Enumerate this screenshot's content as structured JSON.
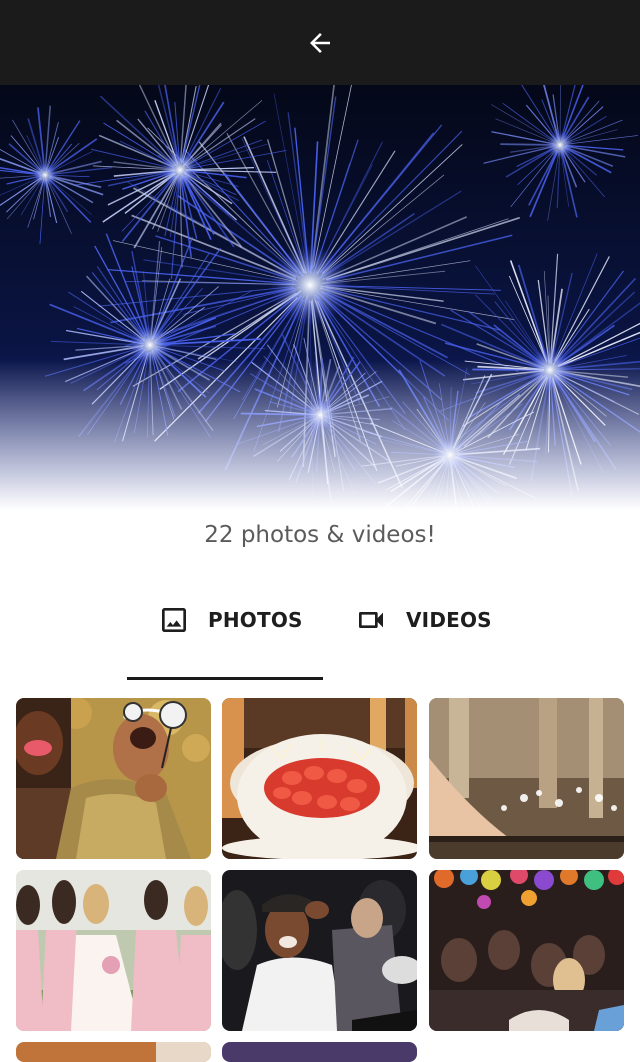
{
  "header": {
    "back_icon": "arrow-left-icon"
  },
  "hero": {
    "image": "fireworks"
  },
  "gallery": {
    "count_text": "22 photos & videos!"
  },
  "tabs": [
    {
      "label": "PHOTOS",
      "icon": "image-icon",
      "selected": true
    },
    {
      "label": "VIDEOS",
      "icon": "video-camera-icon",
      "selected": false
    }
  ],
  "colors": {
    "topbar": "#1b1b1b",
    "indicator": "#1a1a1a",
    "count_text": "#5b5b5b"
  },
  "media_items": [
    {
      "subject": "laughing people with party props"
    },
    {
      "subject": "strawberry cake with sparklers"
    },
    {
      "subject": "chandelier and candles"
    },
    {
      "subject": "bridesmaids in pink dresses"
    },
    {
      "subject": "crowd dancing at party"
    },
    {
      "subject": "party crowd with balloons"
    }
  ]
}
